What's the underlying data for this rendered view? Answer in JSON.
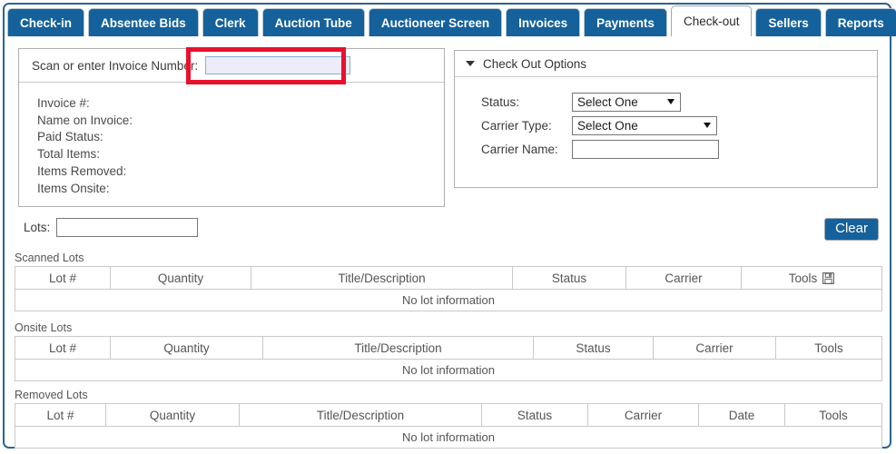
{
  "tabs": [
    {
      "label": "Check-in",
      "active": false
    },
    {
      "label": "Absentee Bids",
      "active": false
    },
    {
      "label": "Clerk",
      "active": false
    },
    {
      "label": "Auction Tube",
      "active": false
    },
    {
      "label": "Auctioneer Screen",
      "active": false
    },
    {
      "label": "Invoices",
      "active": false
    },
    {
      "label": "Payments",
      "active": false
    },
    {
      "label": "Check-out",
      "active": true
    },
    {
      "label": "Sellers",
      "active": false
    },
    {
      "label": "Reports",
      "active": false
    }
  ],
  "invoice_panel": {
    "scan_label": "Scan or enter Invoice Number:",
    "scan_value": "",
    "scan_placeholder": "",
    "fields": [
      {
        "label": "Invoice #:",
        "value": ""
      },
      {
        "label": "Name on Invoice:",
        "value": ""
      },
      {
        "label": "Paid Status:",
        "value": ""
      },
      {
        "label": "Total Items:",
        "value": ""
      },
      {
        "label": "Items Removed:",
        "value": ""
      },
      {
        "label": "Items Onsite:",
        "value": ""
      }
    ]
  },
  "checkout_options": {
    "title": "Check Out Options",
    "status": {
      "label": "Status:",
      "value": "Select One"
    },
    "carrier_type": {
      "label": "Carrier Type:",
      "value": "Select One"
    },
    "carrier_name": {
      "label": "Carrier Name:",
      "value": "",
      "placeholder": ""
    }
  },
  "lots": {
    "label": "Lots:",
    "value": "",
    "placeholder": ""
  },
  "clear_button": {
    "label": "Clear"
  },
  "tables": {
    "scanned": {
      "caption": "Scanned Lots",
      "columns": [
        "Lot #",
        "Quantity",
        "Title/Description",
        "Status",
        "Carrier",
        "Tools"
      ],
      "tools_has_save_icon": true,
      "save_icon_name": "save-icon",
      "rows": [],
      "empty_message": "No lot information"
    },
    "onsite": {
      "caption": "Onsite Lots",
      "columns": [
        "Lot #",
        "Quantity",
        "Title/Description",
        "Status",
        "Carrier",
        "Tools"
      ],
      "tools_has_save_icon": false,
      "rows": [],
      "empty_message": "No lot information"
    },
    "removed": {
      "caption": "Removed Lots",
      "columns": [
        "Lot #",
        "Quantity",
        "Title/Description",
        "Status",
        "Carrier",
        "Date",
        "Tools"
      ],
      "tools_has_save_icon": false,
      "rows": [],
      "empty_message": "No lot information"
    }
  },
  "annotation": {
    "type": "red-highlight-box",
    "target": "invoice-number-input",
    "color": "#e8112d"
  },
  "colors": {
    "tab_blue": "#15619b",
    "frame_blue": "#2a6496",
    "input_highlight_fill": "#ececfb",
    "annotation_red": "#e8112d"
  }
}
